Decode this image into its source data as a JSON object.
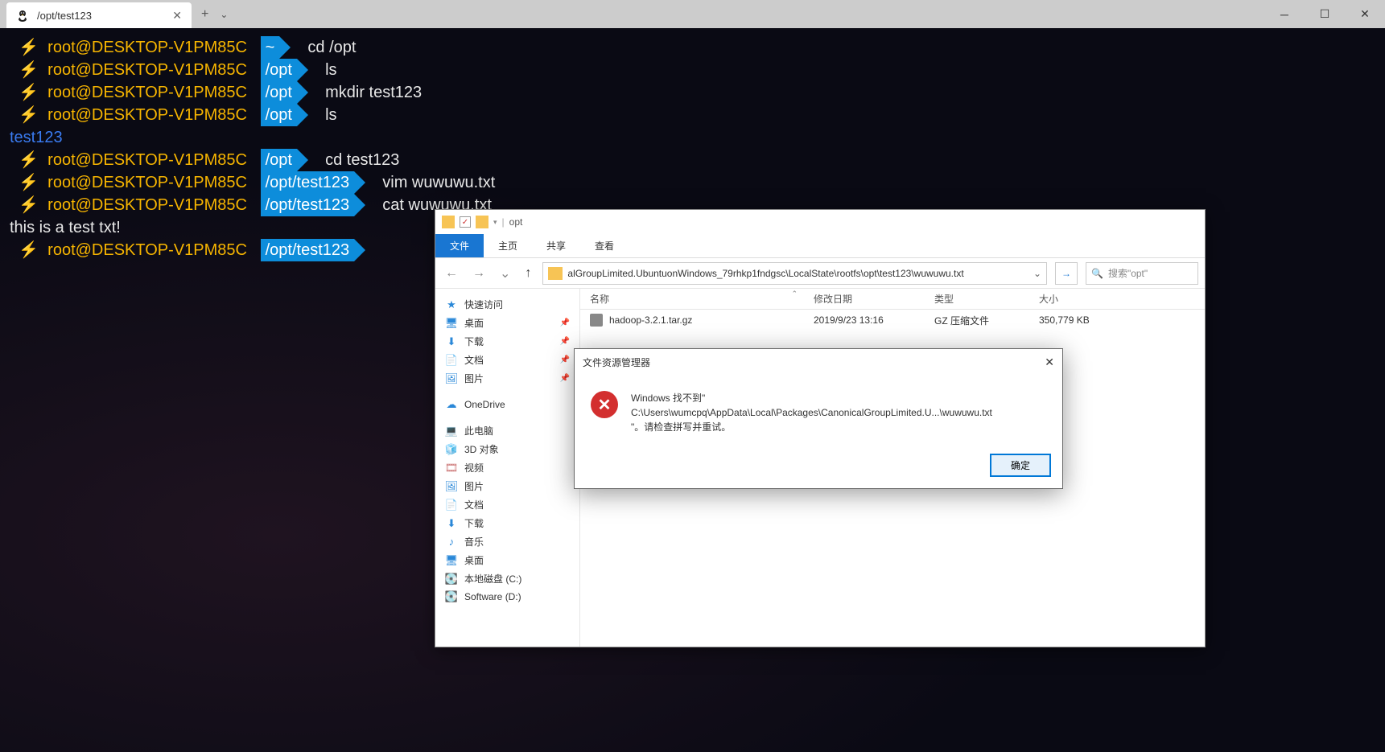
{
  "window": {
    "tab_title": "/opt/test123",
    "new_tab": "+",
    "dropdown": "⌄"
  },
  "terminal": {
    "userhost": "root@DESKTOP-V1PM85C",
    "bolt": "⚡",
    "lines": [
      {
        "path": "~",
        "cmd": "cd /opt"
      },
      {
        "path": "/opt",
        "cmd": "ls"
      },
      {
        "path": "/opt",
        "cmd": "mkdir test123"
      },
      {
        "path": "/opt",
        "cmd": "ls"
      }
    ],
    "output1": "test123",
    "lines2": [
      {
        "path": "/opt",
        "cmd": "cd test123"
      },
      {
        "path": "/opt/test123",
        "cmd": "vim wuwuwu.txt"
      },
      {
        "path": "/opt/test123",
        "cmd": "cat wuwuwu.txt"
      }
    ],
    "output2": "this is a test txt!",
    "prompt_last": {
      "path": "/opt/test123",
      "cmd": ""
    }
  },
  "explorer": {
    "titlebar_text": "opt",
    "titlebar_sep": "|",
    "check": "✓",
    "ribbon": {
      "file": "文件",
      "home": "主页",
      "share": "共享",
      "view": "查看"
    },
    "nav": {
      "back": "←",
      "forward": "→",
      "dropdown": "⌄",
      "up": "↑",
      "address": "alGroupLimited.UbuntuonWindows_79rhkp1fndgsc\\LocalState\\rootfs\\opt\\test123\\wuwuwu.txt",
      "refresh": "→",
      "search_placeholder": "搜索\"opt\""
    },
    "sidebar": {
      "quick": "快速访问",
      "desktop": "桌面",
      "downloads": "下载",
      "documents": "文档",
      "pictures": "图片",
      "onedrive": "OneDrive",
      "thispc": "此电脑",
      "obj3d": "3D 对象",
      "videos": "视频",
      "pictures2": "图片",
      "documents2": "文档",
      "downloads2": "下载",
      "music": "音乐",
      "desktop2": "桌面",
      "diskc": "本地磁盘 (C:)",
      "diskd": "Software (D:)"
    },
    "columns": {
      "name": "名称",
      "date": "修改日期",
      "type": "类型",
      "size": "大小"
    },
    "files": [
      {
        "name": "hadoop-3.2.1.tar.gz",
        "date": "2019/9/23 13:16",
        "type": "GZ 压缩文件",
        "size": "350,779 KB"
      }
    ]
  },
  "dialog": {
    "title": "文件资源管理器",
    "line1": "Windows 找不到\"",
    "line2": "C:\\Users\\wumcpq\\AppData\\Local\\Packages\\CanonicalGroupLimited.U...\\wuwuwu.txt",
    "line3": "\"。请检查拼写并重试。",
    "ok": "确定"
  }
}
